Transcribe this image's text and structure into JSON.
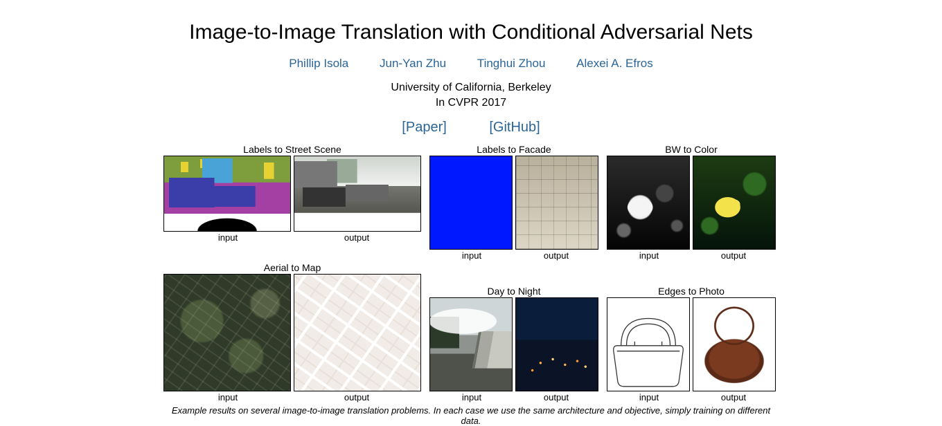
{
  "title": "Image-to-Image Translation with Conditional Adversarial Nets",
  "authors": [
    "Phillip Isola",
    "Jun-Yan Zhu",
    "Tinghui Zhou",
    "Alexei A. Efros"
  ],
  "affiliation": "University of California, Berkeley",
  "venue": "In CVPR 2017",
  "links": {
    "paper": "[Paper]",
    "github": "[GitHub]"
  },
  "labels": {
    "input": "input",
    "output": "output"
  },
  "examples": {
    "street": "Labels to Street Scene",
    "aerial": "Aerial to Map",
    "facade": "Labels to Facade",
    "bw": "BW to Color",
    "daynight": "Day to Night",
    "edges": "Edges to Photo"
  },
  "caption": "Example results on several image-to-image translation problems. In each case we use the same architecture and objective, simply training on different data."
}
